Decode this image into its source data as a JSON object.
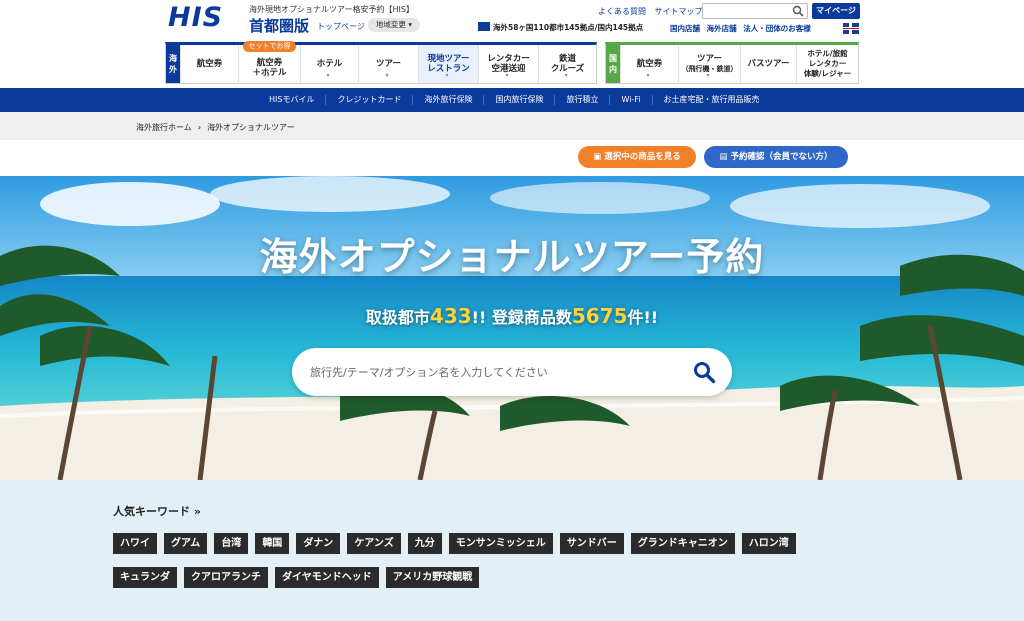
{
  "header": {
    "logo": "HIS",
    "site_tag": "海外現地オプショナルツアー格安予約【HIS】",
    "region": "首都圏版",
    "top_page": "トップページ",
    "region_change": "地域変更",
    "links": [
      "よくある質問",
      "サイトマップ"
    ],
    "search_placeholder": "",
    "mypage": "マイページ",
    "stats": "海外58ヶ国110都市145拠点/国内145拠点",
    "links2": [
      "国内店舗",
      "海外店舗",
      "法人・団体のお客様"
    ]
  },
  "nav_intl": {
    "side": [
      "海",
      "外"
    ],
    "promo": "セットでお得",
    "items": [
      {
        "label1": "航空券",
        "label2": ""
      },
      {
        "label1": "航空券",
        "label2": "＋ホテル"
      },
      {
        "label1": "ホテル",
        "label2": ""
      },
      {
        "label1": "ツアー",
        "label2": ""
      },
      {
        "label1": "現地ツアー",
        "label2": "レストラン"
      },
      {
        "label1": "レンタカー",
        "label2": "空港送迎"
      },
      {
        "label1": "鉄道",
        "label2": "クルーズ"
      }
    ]
  },
  "nav_dom": {
    "side": [
      "国",
      "内"
    ],
    "items": [
      {
        "label1": "航空券",
        "label2": "",
        "label3": ""
      },
      {
        "label1": "ツアー",
        "label2": "（飛行機・鉄道）",
        "label3": ""
      },
      {
        "label1": "バスツアー",
        "label2": "",
        "label3": ""
      },
      {
        "label1": "ホテル/旅館",
        "label2": "レンタカー",
        "label3": "体験/レジャー"
      }
    ]
  },
  "subbar": [
    "HISモバイル",
    "クレジットカード",
    "海外旅行保険",
    "国内旅行保険",
    "旅行積立",
    "Wi-Fi",
    "お土産宅配・旅行用品販売"
  ],
  "breadcrumb": {
    "home": "海外旅行ホーム",
    "sep": "›",
    "current": "海外オプショナルツアー"
  },
  "actions": {
    "cart": "選択中の商品を見る",
    "reserve": "予約確認（会員でない方）"
  },
  "hero": {
    "title": "海外オプショナルツアー予約",
    "sub_a": "取扱都市",
    "sub_num1": "433",
    "sub_b": "!! 登録商品数",
    "sub_num2": "5675",
    "sub_c": "件!!",
    "search_placeholder": "旅行先/テーマ/オプション名を入力してください"
  },
  "keywords": {
    "title": "人気キーワード »",
    "row1": [
      "ハワイ",
      "グアム",
      "台湾",
      "韓国",
      "ダナン",
      "ケアンズ",
      "九分",
      "モンサンミッシェル",
      "サンドバー",
      "グランドキャニオン",
      "ハロン湾"
    ],
    "row2": [
      "キュランダ",
      "クアロアランチ",
      "ダイヤモンドヘッド",
      "アメリカ野球観戦"
    ]
  },
  "colors": {
    "brand": "#0a3a9c",
    "accent": "#f0802a",
    "domestic": "#56a845",
    "reserve": "#2f68c8"
  }
}
